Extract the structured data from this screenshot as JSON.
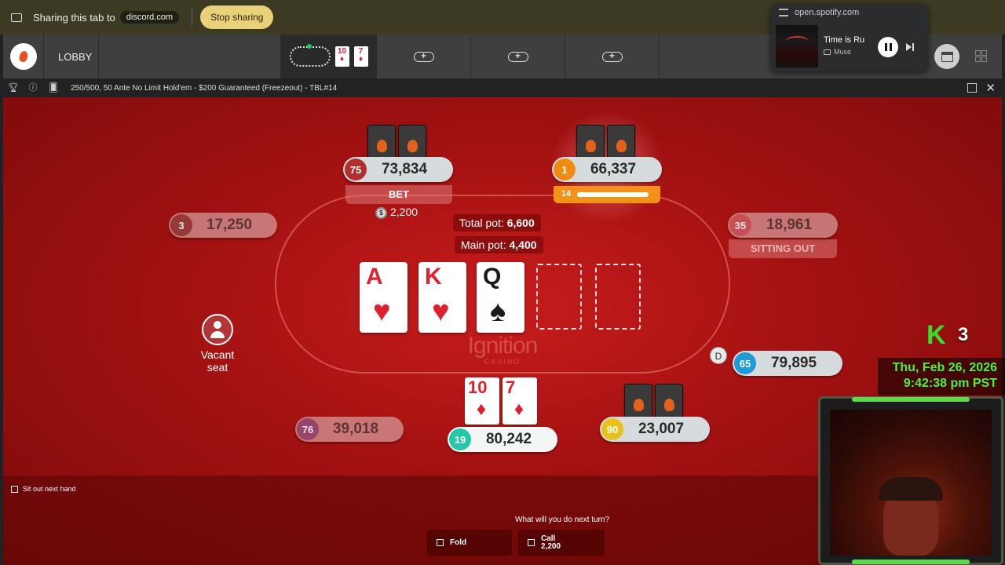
{
  "share_bar": {
    "text": "Sharing this tab to",
    "site": "discord.com",
    "stop_label": "Stop sharing"
  },
  "spotify": {
    "url": "open.spotify.com",
    "title": "Time is Ru",
    "artist": "Muse"
  },
  "nav": {
    "lobby_label": "LOBBY",
    "active_cards": [
      {
        "rank": "10",
        "suit": "♦"
      },
      {
        "rank": "7",
        "suit": "♦"
      }
    ],
    "plus_symbol": "+"
  },
  "table": {
    "title": "250/500, 50 Ante No Limit Hold'em - $200 Guaranteed (Freezeout) - TBL#14",
    "watermark": "Ignition",
    "watermark_sub": "CASINO"
  },
  "pots": {
    "total_label": "Total pot:",
    "total_value": "6,600",
    "main_label": "Main pot:",
    "main_value": "4,400"
  },
  "board": [
    {
      "rank": "A",
      "suit": "♥",
      "color": "red"
    },
    {
      "rank": "K",
      "suit": "♥",
      "color": "red"
    },
    {
      "rank": "Q",
      "suit": "♠",
      "color": "black"
    }
  ],
  "players": {
    "p75": {
      "seat": "75",
      "stack": "73,834",
      "status": "BET",
      "bet": "2,200",
      "badge_color": "#b32f2f"
    },
    "p1": {
      "seat": "1",
      "stack": "66,337",
      "timer": "14",
      "timer_fill": 0.95,
      "badge_color": "#f08a12"
    },
    "p3": {
      "seat": "3",
      "stack": "17,250",
      "badge_color": "#8a2a2a"
    },
    "p35": {
      "seat": "35",
      "stack": "18,961",
      "status": "SITTING OUT",
      "badge_color": "#c5484f"
    },
    "p65": {
      "seat": "65",
      "stack": "79,895",
      "badge_color": "#1e9ad6"
    },
    "p90": {
      "seat": "90",
      "stack": "23,007",
      "badge_color": "#e8c21a"
    },
    "p76": {
      "seat": "76",
      "stack": "39,018",
      "badge_color": "#8a3a6a"
    },
    "hero": {
      "seat": "19",
      "stack": "80,242",
      "badge_color": "#25c7a8",
      "cards": [
        {
          "rank": "10",
          "suit": "♦"
        },
        {
          "rank": "7",
          "suit": "♦"
        }
      ]
    }
  },
  "vacant": {
    "line1": "Vacant",
    "line2": "seat"
  },
  "dealer": "D",
  "chip_symbol": "$",
  "actions": {
    "sit_out_label": "Sit out next hand",
    "question": "What will you do next turn?",
    "fold_label": "Fold",
    "call_label": "Call",
    "call_amount": "2,200"
  },
  "stream": {
    "kick_logo": "K",
    "kick_count": "3",
    "date": "Thu, Feb 26, 2026",
    "time": "9:42:38 pm PST"
  }
}
